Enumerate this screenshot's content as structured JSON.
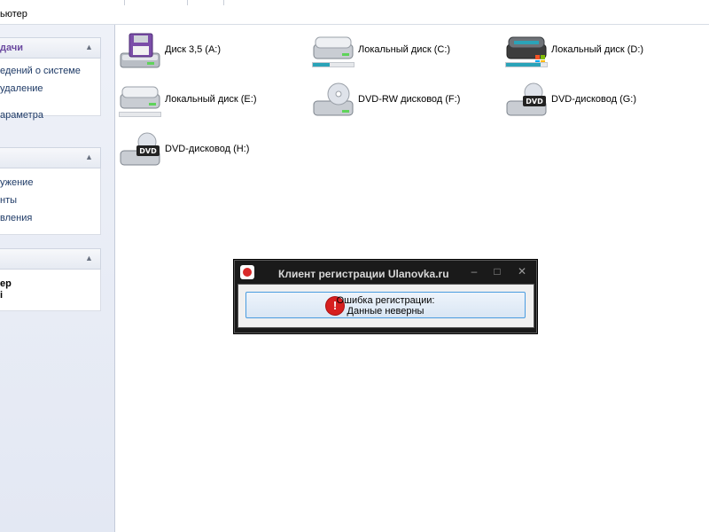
{
  "address": {
    "text": "ьютер"
  },
  "sidebar": {
    "panels": [
      {
        "title": "дачи",
        "links": [
          "едений о системе",
          "удаление",
          "араметра"
        ]
      },
      {
        "title": "",
        "links": [
          "ужение",
          "нты",
          "вления"
        ]
      },
      {
        "title": "",
        "links": [
          "ер",
          "i"
        ]
      }
    ]
  },
  "drives": [
    {
      "label": "Диск 3,5 (A:)",
      "icon": "floppy-drive-icon",
      "usage": null
    },
    {
      "label": "Локальный диск (C:)",
      "icon": "hard-drive-icon",
      "usage": 0.42,
      "color": "#2aa3b8"
    },
    {
      "label": "Локальный диск (D:)",
      "icon": "windows-drive-icon",
      "usage": 0.85,
      "color": "#2aa3b8"
    },
    {
      "label": "Локальный диск (E:)",
      "icon": "hard-drive-icon",
      "usage": 0.0,
      "color": "#2aa3b8"
    },
    {
      "label": "DVD-RW дисковод (F:)",
      "icon": "dvd-rw-drive-icon",
      "usage": null
    },
    {
      "label": "DVD-дисковод (G:)",
      "icon": "dvd-drive-icon",
      "usage": null
    },
    {
      "label": "DVD-дисковод (H:)",
      "icon": "dvd-drive-icon",
      "usage": null
    }
  ],
  "dialog": {
    "title": "Клиент регистрации Ulanovka.ru",
    "message_line1": "Ошибка регистрации:",
    "message_line2": "Данные неверны",
    "error_glyph": "!",
    "accent": "#4a9ce0",
    "error_color": "#d71f1f"
  }
}
